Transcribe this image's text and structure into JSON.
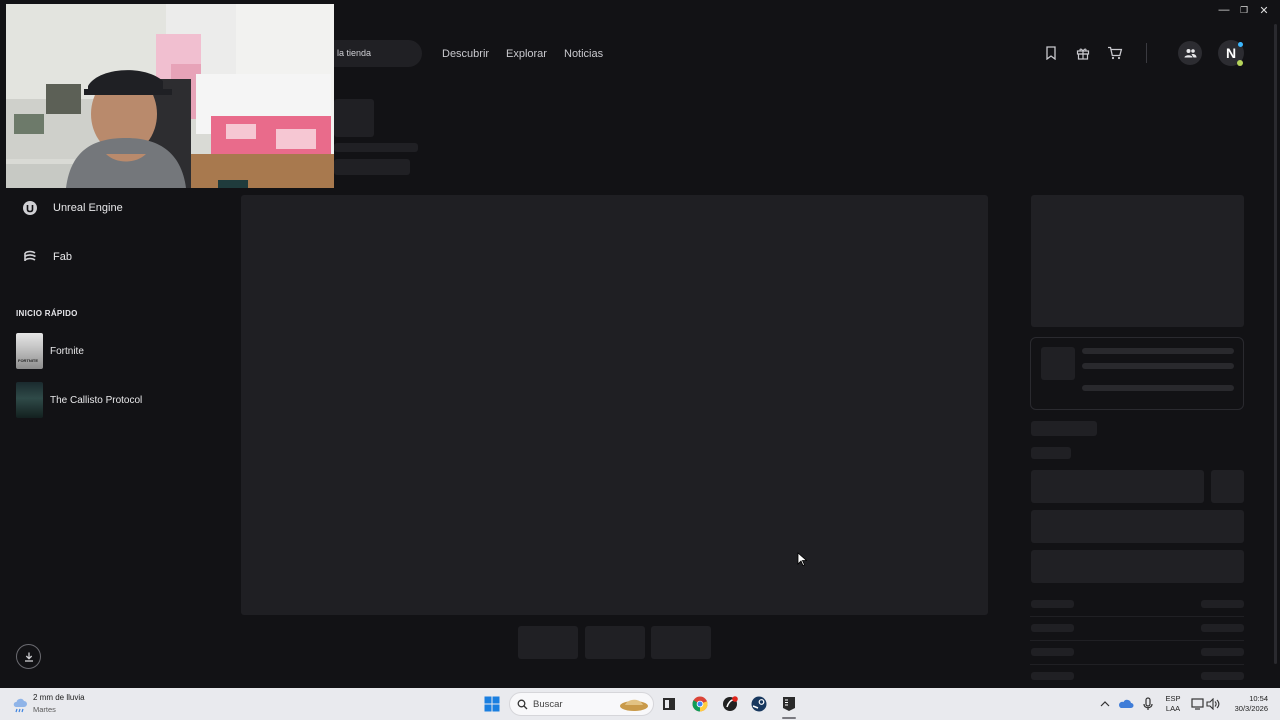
{
  "window": {
    "minimize": "—",
    "maximize": "❐",
    "close": "✕"
  },
  "topnav": {
    "search_text": "la tienda",
    "links": [
      "Descubrir",
      "Explorar",
      "Noticias"
    ],
    "avatar_initial": "N"
  },
  "sidebar": {
    "items": [
      {
        "label": "Unreal Engine",
        "icon": "unreal-icon"
      },
      {
        "label": "Fab",
        "icon": "fab-icon"
      }
    ],
    "quick_launch_title": "INICIO RÁPIDO",
    "quick_launch": [
      {
        "label": "Fortnite",
        "thumb_text": "FORTNITE"
      },
      {
        "label": "The Callisto Protocol"
      }
    ]
  },
  "taskbar": {
    "weather_line1": "2 mm de lluvia",
    "weather_line2": "Martes",
    "search_label": "Buscar",
    "lang_line1": "ESP",
    "lang_line2": "LAA",
    "time": "10:54",
    "date": "30/3/2026"
  },
  "colors": {
    "background": "#121215",
    "skeleton": "#202024",
    "accent_blue": "#3bb7ff",
    "status_green": "#b6d45b"
  }
}
